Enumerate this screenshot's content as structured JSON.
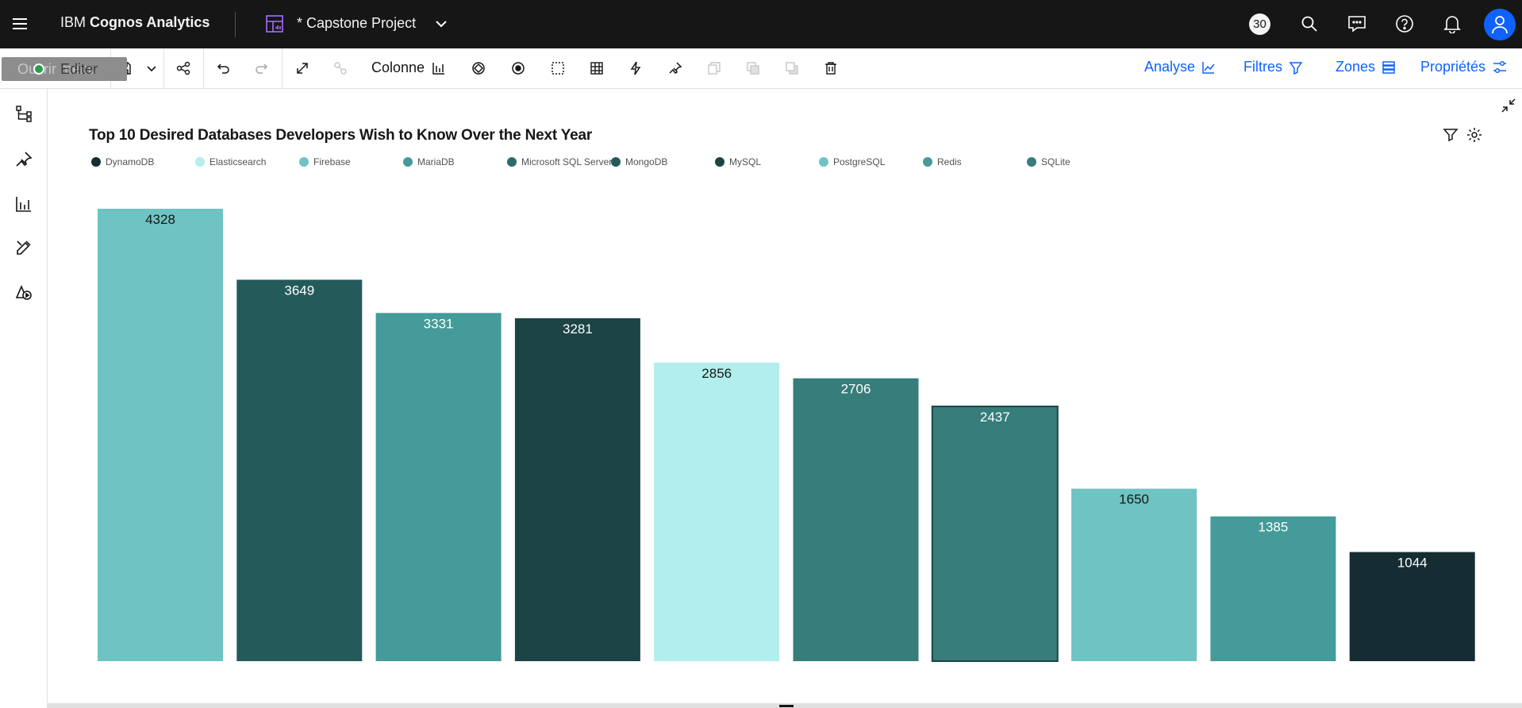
{
  "topbar": {
    "brand_prefix": "IBM",
    "brand_name": "Cognos Analytics",
    "project_title": "* Capstone Project",
    "notification_count": "30"
  },
  "toolbar": {
    "edit_under_label": "Ouvrir menu",
    "edit_label": "Editer",
    "visualization_type": "Colonne",
    "analyse_label": "Analyse",
    "filtres_label": "Filtres",
    "zones_label": "Zones",
    "proprietes_label": "Propriétés"
  },
  "colors": {
    "topbar_bg": "#161616",
    "accent": "#0f62fe"
  },
  "chart_data": {
    "type": "bar",
    "title": "Top 10 Desired Databases Developers Wish to Know Over the Next Year",
    "legend": [
      {
        "name": "DynamoDB",
        "color": "#152d32"
      },
      {
        "name": "Elasticsearch",
        "color": "#b2eeee"
      },
      {
        "name": "Firebase",
        "color": "#6fc3c3"
      },
      {
        "name": "MariaDB",
        "color": "#449b99"
      },
      {
        "name": "Microsoft SQL Server",
        "color": "#2c6b6b"
      },
      {
        "name": "MongoDB",
        "color": "#245b5a"
      },
      {
        "name": "MySQL",
        "color": "#1c4445"
      },
      {
        "name": "PostgreSQL",
        "color": "#6fc3c3"
      },
      {
        "name": "Redis",
        "color": "#449b99"
      },
      {
        "name": "SQLite",
        "color": "#367d7b"
      }
    ],
    "bars": [
      {
        "category": "PostgreSQL",
        "value": 4328,
        "color": "#6fc3c3",
        "label_color": "#161616"
      },
      {
        "category": "MongoDB",
        "value": 3649,
        "color": "#245b5a",
        "label_color": "#ffffff"
      },
      {
        "category": "Redis",
        "value": 3331,
        "color": "#449b99",
        "label_color": "#ffffff"
      },
      {
        "category": "MySQL",
        "value": 3281,
        "color": "#1c4445",
        "label_color": "#ffffff"
      },
      {
        "category": "Elasticsearch",
        "value": 2856,
        "color": "#b2eeee",
        "label_color": "#161616"
      },
      {
        "category": "Microsoft SQL Server",
        "value": 2706,
        "color": "#367d7b",
        "label_color": "#ffffff"
      },
      {
        "category": "SQLite",
        "value": 2437,
        "color": "#367d7b",
        "label_color": "#ffffff"
      },
      {
        "category": "Firebase",
        "value": 1650,
        "color": "#6fc3c3",
        "label_color": "#161616"
      },
      {
        "category": "MariaDB",
        "value": 1385,
        "color": "#449b99",
        "label_color": "#ffffff"
      },
      {
        "category": "DynamoDB",
        "value": 1044,
        "color": "#152d32",
        "label_color": "#ffffff"
      }
    ],
    "ylim": [
      0,
      4328
    ]
  }
}
